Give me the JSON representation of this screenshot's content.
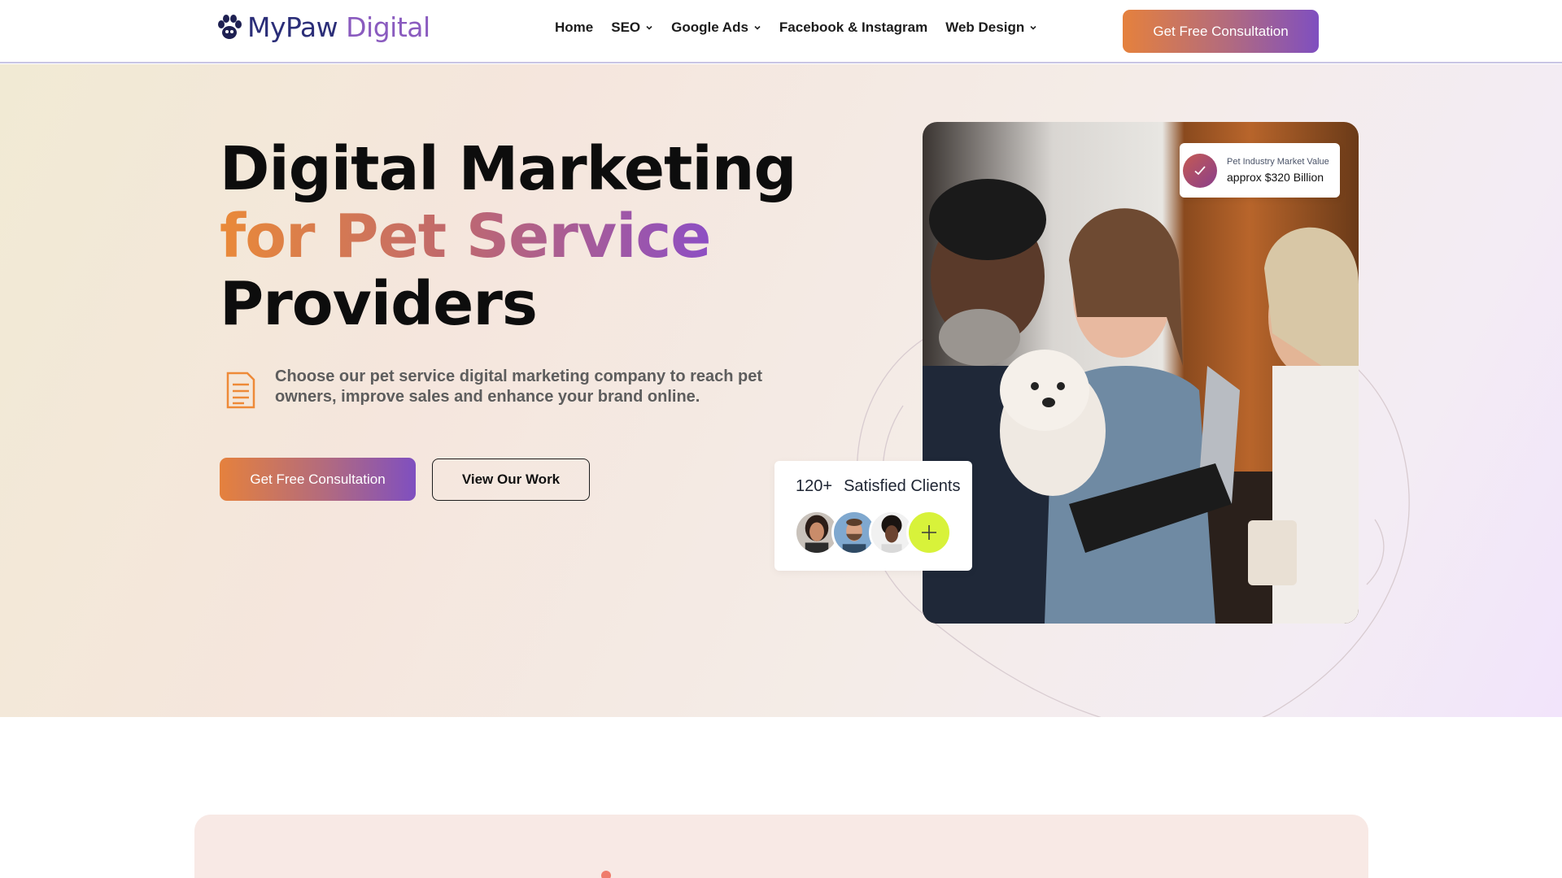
{
  "header": {
    "logo": {
      "my": "MyPaw",
      "digital": "Digital"
    },
    "nav": [
      {
        "label": "Home",
        "has_dropdown": false
      },
      {
        "label": "SEO",
        "has_dropdown": true
      },
      {
        "label": "Google Ads",
        "has_dropdown": true
      },
      {
        "label": "Facebook & Instagram",
        "has_dropdown": false
      },
      {
        "label": "Web Design",
        "has_dropdown": true
      }
    ],
    "cta_label": "Get Free Consultation"
  },
  "hero": {
    "title_line1": "Digital Marketing",
    "title_line2": "for Pet Service",
    "title_line3": "Providers",
    "description": "Choose our pet service digital marketing company to reach pet owners, improve sales and enhance your brand online.",
    "primary_button": "Get Free Consultation",
    "secondary_button": "View Our Work",
    "market_card": {
      "label": "Pet Industry Market Value",
      "value": "approx $320 Billion"
    },
    "clients_card": {
      "count": "120+",
      "label": "Satisfied Clients"
    }
  },
  "icons": [
    "paw-icon",
    "chevron-down-icon",
    "document-icon",
    "check-icon",
    "plus-icon"
  ],
  "colors": {
    "brand_orange": "#e5813d",
    "brand_purple": "#7f4fc0",
    "accent_lime": "#d8f23a",
    "navy": "#2b2e78"
  }
}
